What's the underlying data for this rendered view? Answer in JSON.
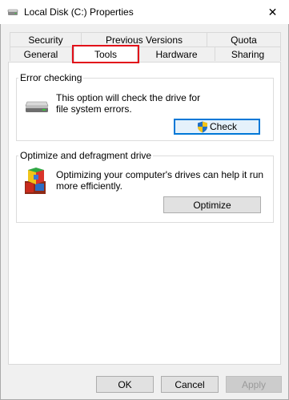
{
  "window": {
    "title": "Local Disk (C:) Properties",
    "close_glyph": "✕"
  },
  "tabs": {
    "row1": [
      "Security",
      "Previous Versions",
      "Quota"
    ],
    "row2": [
      "General",
      "Tools",
      "Hardware",
      "Sharing"
    ],
    "active": "Tools"
  },
  "error_checking": {
    "heading": "Error checking",
    "description": "This option will check the drive for file system errors.",
    "button_label": "Check",
    "icon": "drive-icon"
  },
  "optimize": {
    "heading": "Optimize and defragment drive",
    "description": "Optimizing your computer's drives can help it run more efficiently.",
    "button_label": "Optimize",
    "icon": "defrag-icon"
  },
  "footer": {
    "ok_label": "OK",
    "cancel_label": "Cancel",
    "apply_label": "Apply"
  },
  "colors": {
    "highlight": "#e2101a",
    "focus": "#0078d7"
  }
}
